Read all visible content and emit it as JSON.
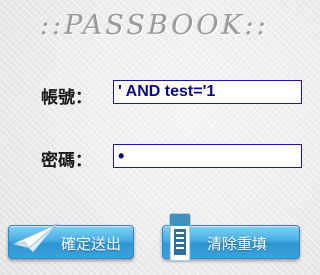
{
  "header": {
    "title": "::PASSBOOK::"
  },
  "form": {
    "username_label": "帳號：",
    "username_value": "' AND test='1",
    "password_label": "密碼：",
    "password_value": "•",
    "submit_label": "確定送出",
    "reset_label": "清除重填"
  },
  "icons": {
    "submit": "paper-plane-icon",
    "reset": "eraser-icon"
  },
  "colors": {
    "button": "#46ade5",
    "field_border": "#1a1aa0",
    "field_text": "#0a0a80",
    "title": "#9a9a9a"
  }
}
